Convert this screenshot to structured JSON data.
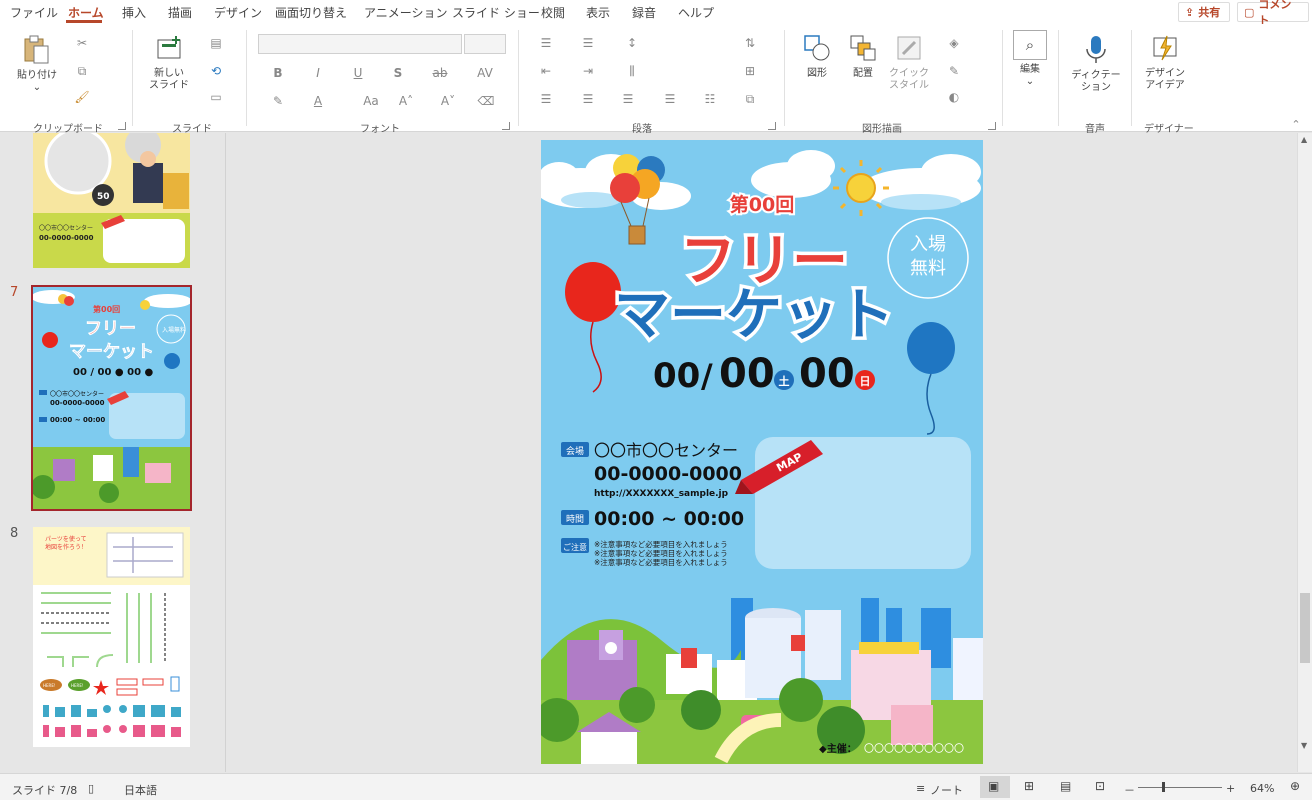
{
  "menu": {
    "tabs": [
      "ファイル",
      "ホーム",
      "挿入",
      "描画",
      "デザイン",
      "画面切り替え",
      "アニメーション",
      "スライド ショー",
      "校閲",
      "表示",
      "録音",
      "ヘルプ"
    ],
    "active_tab": "ホーム",
    "share_label": "共有",
    "comment_label": "コメント"
  },
  "ribbon": {
    "clipboard": {
      "paste_label": "貼り付け",
      "group_label": "クリップボード"
    },
    "slides": {
      "new_slide_line1": "新しい",
      "new_slide_line2": "スライド",
      "group_label": "スライド"
    },
    "font": {
      "bold": "B",
      "italic": "I",
      "underline": "U",
      "shadow": "S",
      "strike": "ab",
      "spacing": "AV",
      "case": "Aa",
      "group_label": "フォント"
    },
    "paragraph": {
      "group_label": "段落"
    },
    "drawing": {
      "shapes_label": "図形",
      "arrange_label": "配置",
      "quick_style_line1": "クイック",
      "quick_style_line2": "スタイル",
      "group_label": "図形描画"
    },
    "editing": {
      "label": "編集"
    },
    "voice": {
      "dictate_line1": "ディクテー",
      "dictate_line2": "ション",
      "group_label": "音声"
    },
    "designer": {
      "line1": "デザイン",
      "line2": "アイデア",
      "group_label": "デザイナー"
    }
  },
  "thumbnails": [
    {
      "number": "",
      "phone": "00-0000-0000",
      "venue": "〇〇市〇〇センター",
      "badge": "50"
    },
    {
      "number": "7",
      "edition": "第00回",
      "title1": "フリー",
      "title2": "マーケット",
      "date": "00 / 00 ● 00 ●",
      "venue": "〇〇市〇〇センター",
      "phone": "00-0000-0000",
      "time": "00:00 ~ 00:00",
      "entry": "入場無料"
    },
    {
      "number": "8",
      "note1": "パーツを使って",
      "note2": "地図を作ろう！",
      "bubble1": "HERE!",
      "bubble2": "HERE!"
    }
  ],
  "slide": {
    "edition": "第00回",
    "title_line1": "フリー",
    "title_line2": "マーケット",
    "free_entry_1": "入場",
    "free_entry_2": "無料",
    "date_month": "00",
    "date_slash": "/",
    "date_day": "00",
    "day_sat": "土",
    "date_day2": "00",
    "day_sun": "日",
    "venue_tag": "会場",
    "venue": "〇〇市〇〇センター",
    "phone": "00-0000-0000",
    "url": "http://XXXXXXX_sample.jp",
    "time_tag": "時間",
    "time": "00:00 ~ 00:00",
    "notice_tag": "ご注意",
    "notices": [
      "※注意事項など必要項目を入れましょう",
      "※注意事項など必要項目を入れましょう",
      "※注意事項など必要項目を入れましょう"
    ],
    "map_label": "MAP",
    "organizer_label": "◆主催：",
    "organizer": "〇〇〇〇〇〇〇〇〇〇"
  },
  "status": {
    "slide_indicator": "スライド 7/8",
    "language": "日本語",
    "notes_label": "ノート",
    "zoom_minus": "－",
    "zoom_plus": "+",
    "zoom_value": "64%"
  },
  "colors": {
    "accent": "#b7472a",
    "slide_bg": "#7ecbef",
    "title_red": "#e8403a",
    "title_blue": "#1f6fba",
    "balloon_red": "#e8261c",
    "balloon_blue": "#1f76c2"
  }
}
